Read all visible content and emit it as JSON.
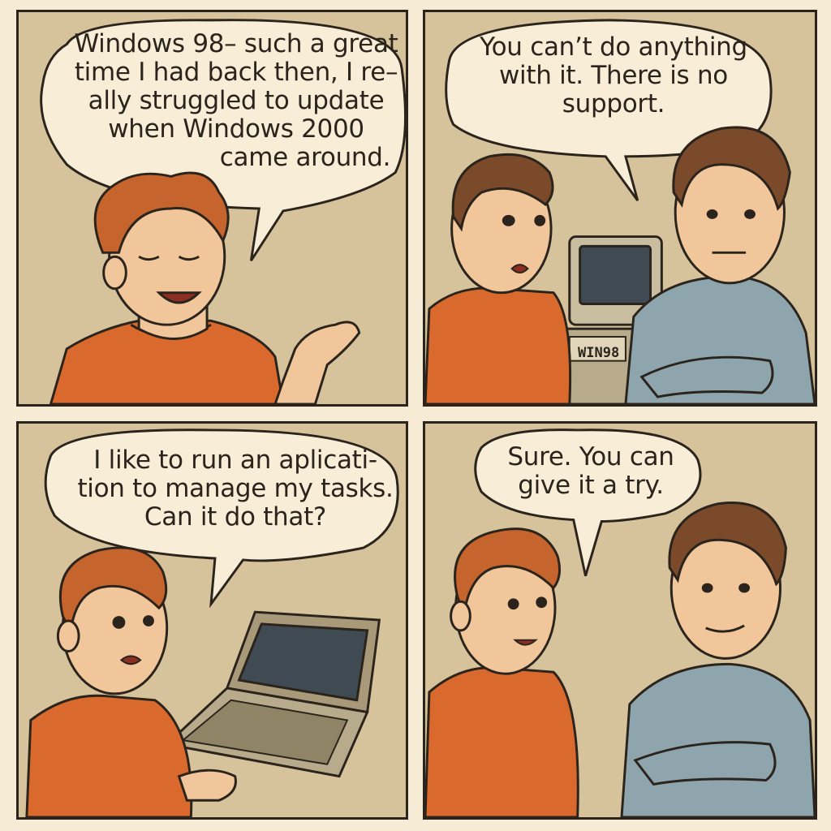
{
  "panels": [
    {
      "id": "panel-1",
      "speech": [
        "Windows 98– such a great",
        "time I had back then, I re–",
        "ally struggled to update",
        "when Windows 2000",
        "came around."
      ]
    },
    {
      "id": "panel-2",
      "speech": [
        "You can’t do anything",
        "with it. There is no",
        "support."
      ],
      "computer_label": "WIN98"
    },
    {
      "id": "panel-3",
      "speech": [
        "I like to run an aplicati-",
        "tion to manage my tasks.",
        "Can it do that?"
      ]
    },
    {
      "id": "panel-4",
      "speech": [
        "Sure. You can",
        "give it a try."
      ]
    }
  ],
  "colors": {
    "ink": "#2b241c",
    "panel_bg": "#d6c39c",
    "page_bg": "#f6ecd5",
    "bubble": "#f8eed8",
    "skin": "#f0c69a",
    "hair_red": "#c5642c",
    "shirt_orange": "#d9692c",
    "shirt_blue": "#8ea5ad",
    "hair_brown": "#7b4a2a"
  }
}
